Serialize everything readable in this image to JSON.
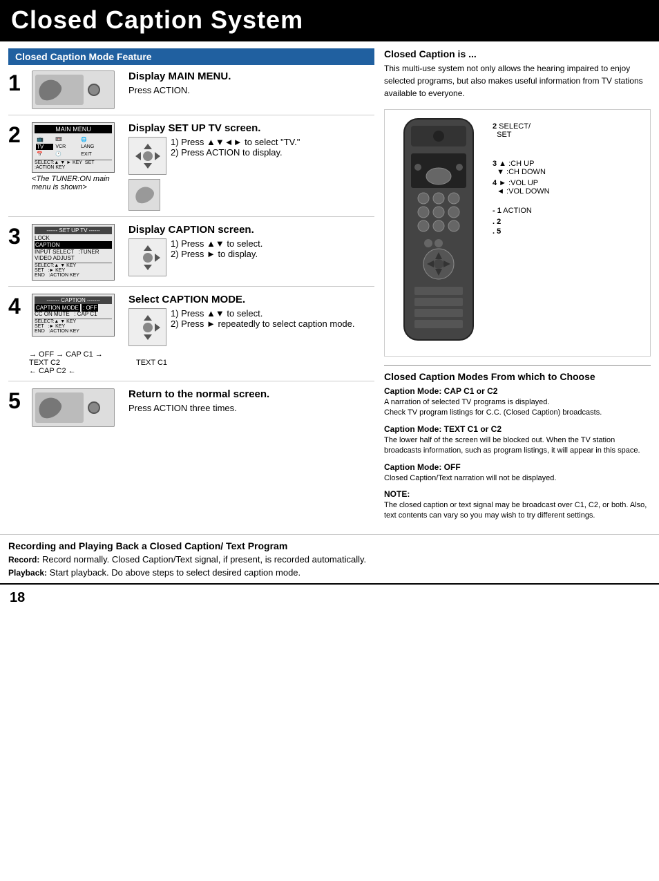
{
  "page": {
    "title": "Closed Caption System",
    "number": "18"
  },
  "left_section": {
    "header": "Closed Caption Mode Feature",
    "steps": [
      {
        "number": "1",
        "title": "Display MAIN MENU.",
        "instruction": "Press ACTION."
      },
      {
        "number": "2",
        "title": "Display SET UP TV screen.",
        "sub_instructions": [
          "1) Press ▲▼◄► to select \"TV.\"",
          "2) Press ACTION to display."
        ],
        "note": "<The TUNER:ON main menu is shown>"
      },
      {
        "number": "3",
        "title": "Display CAPTION screen.",
        "sub_instructions": [
          "1) Press ▲▼ to select.",
          "2) Press ► to display."
        ]
      },
      {
        "number": "4",
        "title": "Select CAPTION MODE.",
        "sub_instructions": [
          "1) Press ▲▼ to select.",
          "2) Press ► repeatedly to select caption mode."
        ]
      },
      {
        "number": "5",
        "title": "Return to the normal screen.",
        "instruction": "Press ACTION three times."
      }
    ],
    "caption_diagram": {
      "line1": "→ OFF → CAP C1 →",
      "line2_left": "TEXT C2",
      "line2_right": "TEXT C1",
      "line3": "← CAP C2 ←"
    }
  },
  "bottom_section": {
    "title": "Recording and Playing Back a Closed Caption/ Text Program",
    "record_label": "Record:",
    "record_text": "Record normally. Closed Caption/Text signal, if present, is recorded automatically.",
    "playback_label": "Playback:",
    "playback_text": "Start playback. Do above steps to select desired caption mode."
  },
  "right_section": {
    "closed_caption_is": {
      "title": "Closed Caption is ...",
      "body": "This multi-use system not only allows the hearing impaired to enjoy selected programs, but also makes useful information from TV stations available to everyone."
    },
    "remote_labels": [
      {
        "number": "2",
        "text": "SELECT/ SET"
      },
      {
        "number": "3",
        "text": "▲ :CH UP  ▼ :CH DOWN"
      },
      {
        "number": "4",
        "text": "► :VOL UP  ◄ :VOL DOWN"
      },
      {
        "number": "1",
        "text": "ACTION"
      },
      {
        "number": "2",
        "text": ""
      },
      {
        "number": "5",
        "text": ""
      }
    ],
    "cc_modes": {
      "title": "Closed Caption Modes From which to Choose",
      "modes": [
        {
          "subtitle": "Caption Mode: CAP C1 or C2",
          "body": "A narration of selected TV programs is displayed.\nCheck TV program listings for C.C. (Closed Caption) broadcasts."
        },
        {
          "subtitle": "Caption Mode: TEXT C1 or C2",
          "body": "The lower half of the screen will be blocked out. When the TV station broadcasts information, such as program listings, it will appear in this space."
        },
        {
          "subtitle": "Caption Mode: OFF",
          "body": "Closed Caption/Text narration will not be displayed."
        },
        {
          "subtitle": "NOTE:",
          "body": "The closed caption or text signal may be broadcast over C1, C2, or both. Also, text contents can vary so you may wish to try different settings."
        }
      ]
    }
  }
}
